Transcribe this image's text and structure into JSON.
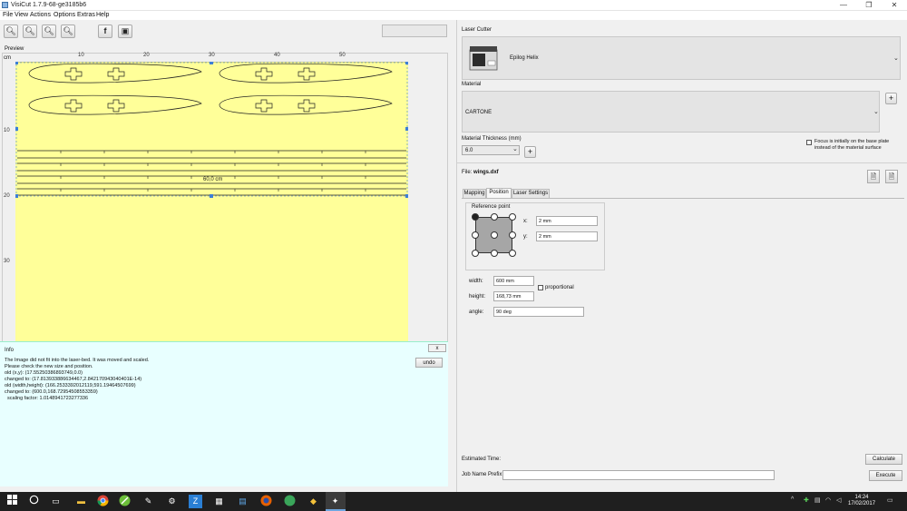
{
  "window": {
    "title": "VisiCut 1.7.9-68-ge3185b6"
  },
  "window_controls": {
    "minimize": "—",
    "restore": "❐",
    "close": "✕"
  },
  "menu": [
    "File",
    "View",
    "Actions",
    "Options",
    "Extras",
    "Help"
  ],
  "preview": {
    "label": "Preview",
    "unit": "cm",
    "x_ticks": [
      "10",
      "20",
      "30",
      "40",
      "50"
    ],
    "y_ticks": [
      "10",
      "20",
      "30"
    ],
    "size_label": "60,0 cm"
  },
  "info": {
    "title": "Info",
    "close": "x",
    "undo": "undo",
    "lines": [
      "The Image did not fit into the laser-bed. It was moved and scaled.",
      "Please check the new size and position.",
      "old (x,y): (17.55250386893749,0.0)",
      "changed to: (17.813933886634467,2.842170943040401E-14)",
      "old (width,height): (166.2533392012119,591.19464507699)",
      "changed to: (600.0,168.72954508553359)",
      "  scaling factor: 1.0148941723277336"
    ]
  },
  "laser_cutter": {
    "label": "Laser Cutter",
    "name": "Epilog Helix"
  },
  "material": {
    "label": "Material",
    "name": "CARTONE",
    "add": "+"
  },
  "thickness": {
    "label": "Material Thickness (mm)",
    "value": "6.0",
    "add": "+"
  },
  "focus": {
    "text1": "Focus is initially on the base plate",
    "text2": "instead of the material surface"
  },
  "file": {
    "prefix": "File: ",
    "name": "wings.dxf"
  },
  "tabs": [
    "Mapping",
    "Position",
    "Laser Settings"
  ],
  "position": {
    "reference_label": "Reference point",
    "x_label": "x:",
    "x_value": "2 mm",
    "y_label": "y:",
    "y_value": "2 mm",
    "width_label": "width:",
    "width_value": "600 mm",
    "proportional": "proportional",
    "height_label": "height:",
    "height_value": "168,73 mm",
    "angle_label": "angle:",
    "angle_value": "90 deg"
  },
  "bottom": {
    "estimated_time": "Estimated Time:",
    "calculate": "Calculate",
    "job_prefix": "Job Name Prefix:",
    "execute": "Execute"
  },
  "taskbar": {
    "time": "14:24",
    "date": "17/02/2017",
    "store_letter": "Z"
  },
  "colors": {
    "bed": "#ffff99",
    "info_bg": "#e8ffff",
    "handle": "#3d7fd6"
  }
}
